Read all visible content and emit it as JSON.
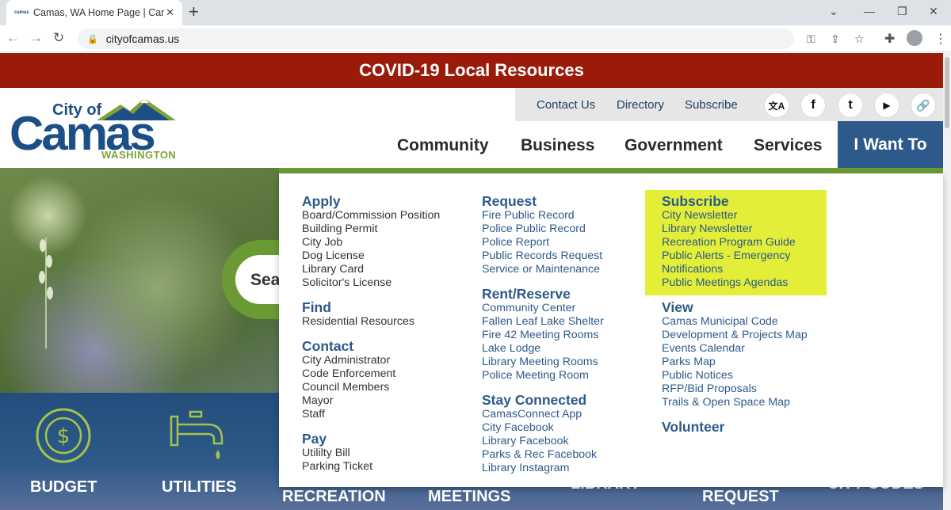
{
  "browser": {
    "tab_title": "Camas, WA Home Page | Camas,",
    "favicon_text": "camas",
    "url": "cityofcamas.us"
  },
  "site": {
    "banner": "COVID-19 Local Resources",
    "logo": {
      "city_of": "City of",
      "camas": "Camas",
      "washington": "WASHINGTON"
    },
    "util_links": [
      "Contact Us",
      "Directory",
      "Subscribe"
    ],
    "social": {
      "translate": "文A",
      "facebook": "f",
      "twitter": "t",
      "youtube": "▶",
      "link": "🔗"
    },
    "nav": [
      "Community",
      "Business",
      "Government",
      "Services",
      "I Want To"
    ],
    "search_partial": "Sea",
    "quick_links": [
      "BUDGET",
      "UTILITIES",
      "RECREATION",
      "MEETINGS",
      "LIBRARY",
      "REQUEST",
      "CITY CODES"
    ]
  },
  "menu": {
    "col1": [
      {
        "heading": "Apply",
        "items": [
          "Board/Commission Position",
          "Building Permit",
          "City Job",
          "Dog License",
          "Library Card",
          "Solicitor's License"
        ]
      },
      {
        "heading": "Find",
        "items": [
          "Residential Resources"
        ]
      },
      {
        "heading": "Contact",
        "items": [
          "City Administrator",
          "Code Enforcement",
          "Council Members",
          "Mayor",
          "Staff"
        ]
      },
      {
        "heading": "Pay",
        "items": [
          "Utililty Bill",
          "Parking Ticket"
        ]
      }
    ],
    "col2": [
      {
        "heading": "Request",
        "items": [
          "Fire Public Record",
          "Police Public Record",
          "Police Report",
          "Public Records Request",
          "Service or Maintenance"
        ]
      },
      {
        "heading": "Rent/Reserve",
        "items": [
          "Community Center",
          "Fallen Leaf Lake Shelter",
          "Fire 42 Meeting Rooms",
          "Lake Lodge",
          "Library Meeting Rooms",
          "Police Meeting Room"
        ]
      },
      {
        "heading": "Stay Connected",
        "items": [
          "CamasConnect App",
          "City Facebook",
          "Library Facebook",
          "Parks & Rec Facebook",
          "Library Instagram"
        ]
      }
    ],
    "col3": [
      {
        "heading": "Subscribe",
        "items": [
          "City Newsletter",
          "Library Newsletter",
          "Recreation Program Guide",
          "Public Alerts - Emergency",
          "Notifications",
          "Public Meetings Agendas"
        ]
      },
      {
        "heading": "View",
        "items": [
          "Camas Municipal Code",
          "Development & Projects Map",
          "Events Calendar",
          "Parks Map",
          "Public Notices",
          "RFP/Bid Proposals",
          "Trails & Open Space Map"
        ]
      },
      {
        "heading": "Volunteer",
        "items": []
      }
    ]
  },
  "colors": {
    "banner_red": "#9b1b0b",
    "brand_blue": "#2d5a8a",
    "accent_green": "#6b9a34",
    "highlight_yellow": "#e2ee38"
  }
}
